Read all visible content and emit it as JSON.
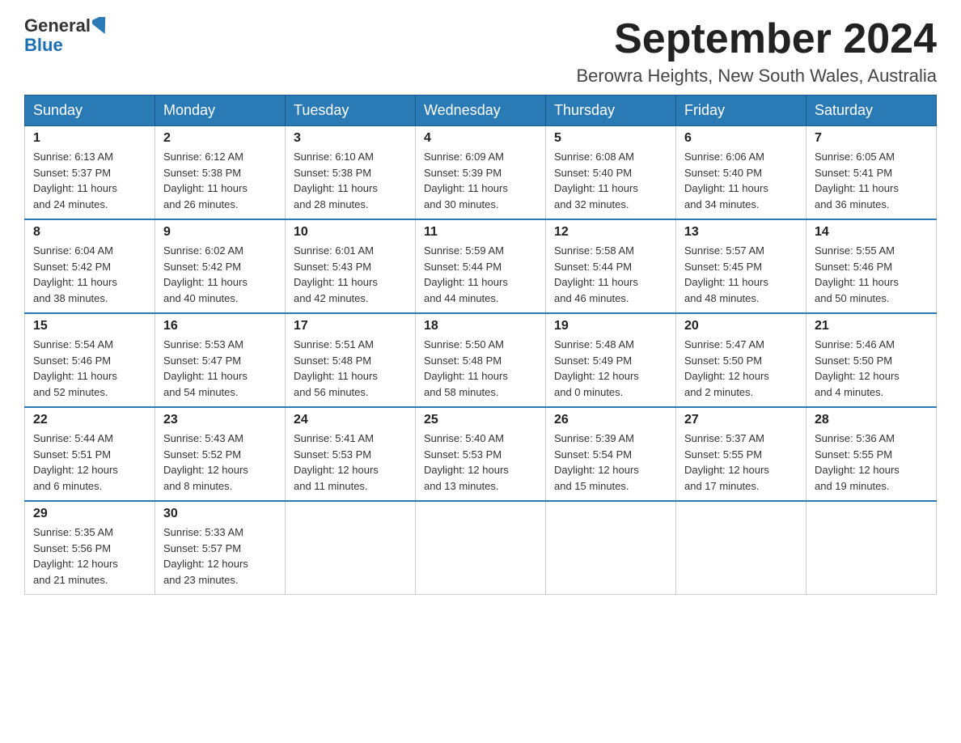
{
  "header": {
    "logo_general": "General",
    "logo_blue": "Blue",
    "month_title": "September 2024",
    "location": "Berowra Heights, New South Wales, Australia"
  },
  "weekdays": [
    "Sunday",
    "Monday",
    "Tuesday",
    "Wednesday",
    "Thursday",
    "Friday",
    "Saturday"
  ],
  "weeks": [
    [
      {
        "day": "1",
        "info": "Sunrise: 6:13 AM\nSunset: 5:37 PM\nDaylight: 11 hours\nand 24 minutes."
      },
      {
        "day": "2",
        "info": "Sunrise: 6:12 AM\nSunset: 5:38 PM\nDaylight: 11 hours\nand 26 minutes."
      },
      {
        "day": "3",
        "info": "Sunrise: 6:10 AM\nSunset: 5:38 PM\nDaylight: 11 hours\nand 28 minutes."
      },
      {
        "day": "4",
        "info": "Sunrise: 6:09 AM\nSunset: 5:39 PM\nDaylight: 11 hours\nand 30 minutes."
      },
      {
        "day": "5",
        "info": "Sunrise: 6:08 AM\nSunset: 5:40 PM\nDaylight: 11 hours\nand 32 minutes."
      },
      {
        "day": "6",
        "info": "Sunrise: 6:06 AM\nSunset: 5:40 PM\nDaylight: 11 hours\nand 34 minutes."
      },
      {
        "day": "7",
        "info": "Sunrise: 6:05 AM\nSunset: 5:41 PM\nDaylight: 11 hours\nand 36 minutes."
      }
    ],
    [
      {
        "day": "8",
        "info": "Sunrise: 6:04 AM\nSunset: 5:42 PM\nDaylight: 11 hours\nand 38 minutes."
      },
      {
        "day": "9",
        "info": "Sunrise: 6:02 AM\nSunset: 5:42 PM\nDaylight: 11 hours\nand 40 minutes."
      },
      {
        "day": "10",
        "info": "Sunrise: 6:01 AM\nSunset: 5:43 PM\nDaylight: 11 hours\nand 42 minutes."
      },
      {
        "day": "11",
        "info": "Sunrise: 5:59 AM\nSunset: 5:44 PM\nDaylight: 11 hours\nand 44 minutes."
      },
      {
        "day": "12",
        "info": "Sunrise: 5:58 AM\nSunset: 5:44 PM\nDaylight: 11 hours\nand 46 minutes."
      },
      {
        "day": "13",
        "info": "Sunrise: 5:57 AM\nSunset: 5:45 PM\nDaylight: 11 hours\nand 48 minutes."
      },
      {
        "day": "14",
        "info": "Sunrise: 5:55 AM\nSunset: 5:46 PM\nDaylight: 11 hours\nand 50 minutes."
      }
    ],
    [
      {
        "day": "15",
        "info": "Sunrise: 5:54 AM\nSunset: 5:46 PM\nDaylight: 11 hours\nand 52 minutes."
      },
      {
        "day": "16",
        "info": "Sunrise: 5:53 AM\nSunset: 5:47 PM\nDaylight: 11 hours\nand 54 minutes."
      },
      {
        "day": "17",
        "info": "Sunrise: 5:51 AM\nSunset: 5:48 PM\nDaylight: 11 hours\nand 56 minutes."
      },
      {
        "day": "18",
        "info": "Sunrise: 5:50 AM\nSunset: 5:48 PM\nDaylight: 11 hours\nand 58 minutes."
      },
      {
        "day": "19",
        "info": "Sunrise: 5:48 AM\nSunset: 5:49 PM\nDaylight: 12 hours\nand 0 minutes."
      },
      {
        "day": "20",
        "info": "Sunrise: 5:47 AM\nSunset: 5:50 PM\nDaylight: 12 hours\nand 2 minutes."
      },
      {
        "day": "21",
        "info": "Sunrise: 5:46 AM\nSunset: 5:50 PM\nDaylight: 12 hours\nand 4 minutes."
      }
    ],
    [
      {
        "day": "22",
        "info": "Sunrise: 5:44 AM\nSunset: 5:51 PM\nDaylight: 12 hours\nand 6 minutes."
      },
      {
        "day": "23",
        "info": "Sunrise: 5:43 AM\nSunset: 5:52 PM\nDaylight: 12 hours\nand 8 minutes."
      },
      {
        "day": "24",
        "info": "Sunrise: 5:41 AM\nSunset: 5:53 PM\nDaylight: 12 hours\nand 11 minutes."
      },
      {
        "day": "25",
        "info": "Sunrise: 5:40 AM\nSunset: 5:53 PM\nDaylight: 12 hours\nand 13 minutes."
      },
      {
        "day": "26",
        "info": "Sunrise: 5:39 AM\nSunset: 5:54 PM\nDaylight: 12 hours\nand 15 minutes."
      },
      {
        "day": "27",
        "info": "Sunrise: 5:37 AM\nSunset: 5:55 PM\nDaylight: 12 hours\nand 17 minutes."
      },
      {
        "day": "28",
        "info": "Sunrise: 5:36 AM\nSunset: 5:55 PM\nDaylight: 12 hours\nand 19 minutes."
      }
    ],
    [
      {
        "day": "29",
        "info": "Sunrise: 5:35 AM\nSunset: 5:56 PM\nDaylight: 12 hours\nand 21 minutes."
      },
      {
        "day": "30",
        "info": "Sunrise: 5:33 AM\nSunset: 5:57 PM\nDaylight: 12 hours\nand 23 minutes."
      },
      {
        "day": "",
        "info": ""
      },
      {
        "day": "",
        "info": ""
      },
      {
        "day": "",
        "info": ""
      },
      {
        "day": "",
        "info": ""
      },
      {
        "day": "",
        "info": ""
      }
    ]
  ]
}
